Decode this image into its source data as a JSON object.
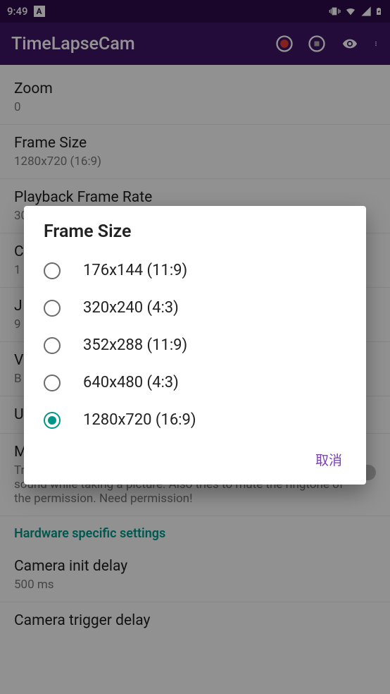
{
  "status": {
    "time": "9:49",
    "icon_letter": "A"
  },
  "appbar": {
    "title": "TimeLapseCam"
  },
  "settings": {
    "zoom": {
      "title": "Zoom",
      "value": "0"
    },
    "frame_size": {
      "title": "Frame Size",
      "value": "1280x720 (16:9)"
    },
    "playback": {
      "title": "Playback Frame Rate",
      "value": "30"
    },
    "c_item": {
      "title": "C",
      "value": "1"
    },
    "j_item": {
      "title": "J",
      "value": "9"
    },
    "v_item": {
      "title": "V",
      "value": "B"
    },
    "u_item": {
      "title": "U"
    },
    "mute": {
      "title": "M",
      "desc": "Tries to mute the phone to prevent it from playing the shutter sound while taking a picture. Also tries to mute the ringtone of the permission. Need permission!"
    },
    "hw_header": "Hardware specific settings",
    "init_delay": {
      "title": "Camera init delay",
      "value": "500 ms"
    },
    "trigger_delay": {
      "title": "Camera trigger delay"
    }
  },
  "dialog": {
    "title": "Frame Size",
    "options": [
      {
        "label": "176x144 (11:9)",
        "selected": false
      },
      {
        "label": "320x240 (4:3)",
        "selected": false
      },
      {
        "label": "352x288 (11:9)",
        "selected": false
      },
      {
        "label": "640x480 (4:3)",
        "selected": false
      },
      {
        "label": "1280x720 (16:9)",
        "selected": true
      }
    ],
    "cancel": "取消"
  }
}
